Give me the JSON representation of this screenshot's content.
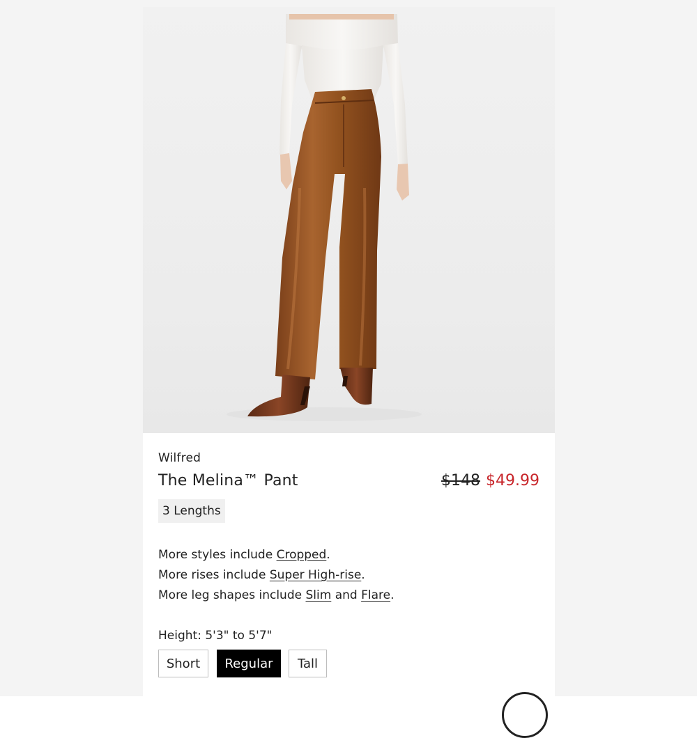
{
  "product": {
    "brand": "Wilfred",
    "title": "The Melina™ Pant",
    "price_original": "$148",
    "price_sale": "$49.99",
    "lengths_badge": "3 Lengths"
  },
  "more_styles": {
    "styles_prefix": "More styles include ",
    "styles_link": "Cropped",
    "rises_prefix": "More rises include ",
    "rises_link": "Super High-rise",
    "legs_prefix": "More leg shapes include ",
    "legs_link_1": "Slim",
    "legs_and": " and ",
    "legs_link_2": "Flare",
    "period": "."
  },
  "sizing": {
    "height_label": "Height: 5'3\" to 5'7\"",
    "options": [
      "Short",
      "Regular",
      "Tall"
    ],
    "selected": "Regular"
  },
  "colors": {
    "sale_red": "#c8262b",
    "selected_bg": "#000000",
    "pant_brown": "#9a5a2c"
  }
}
